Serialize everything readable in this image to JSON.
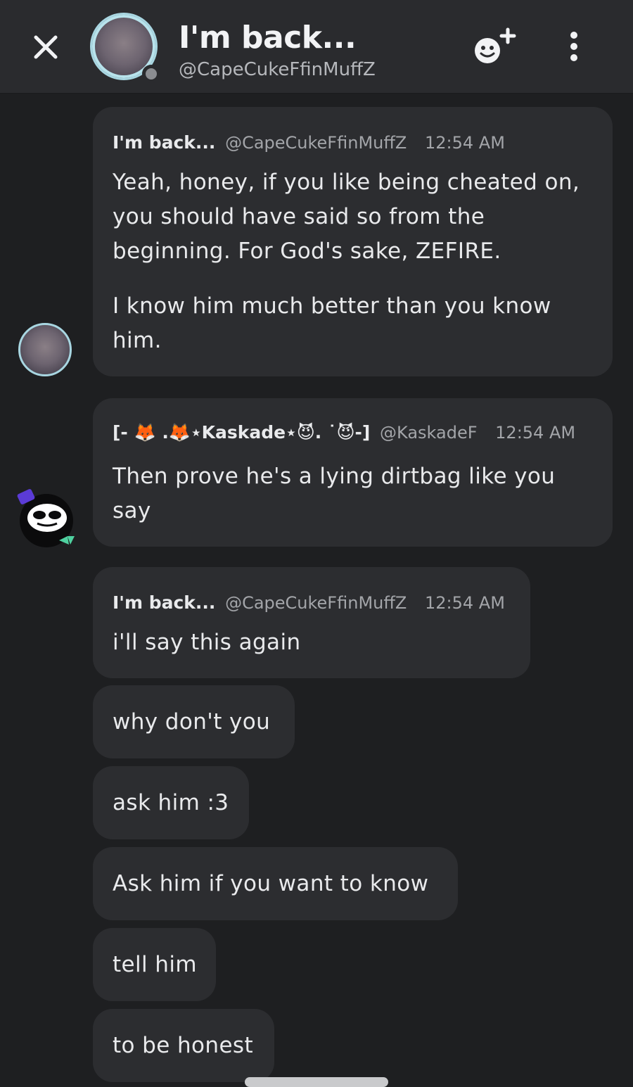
{
  "header": {
    "title": "I'm back...",
    "handle": "@CapeCukeFfinMuffZ",
    "close_icon": "close-icon",
    "add_friend_icon": "add-friend-icon",
    "more_icon": "more-vertical-icon"
  },
  "messages": [
    {
      "author": "I'm back...",
      "username": "@CapeCukeFfinMuffZ",
      "time": "12:54 AM",
      "paragraphs": [
        "Yeah, honey, if you like being cheated on, you should have said so from the beginning. For God's sake, ZEFIRE.",
        "I know him much better than you know him."
      ]
    },
    {
      "author": "[- 🦊 .🦊⋆Kaskade⋆😈. ˙😈-]",
      "username": "@KaskadeF",
      "time": "12:54 AM",
      "paragraphs": [
        "Then prove he's a lying dirtbag like you say"
      ]
    },
    {
      "author": "I'm back...",
      "username": "@CapeCukeFfinMuffZ",
      "time": "12:54 AM",
      "paragraphs": [
        "i'll say this again"
      ]
    }
  ],
  "followups": [
    "why don't you",
    "ask him :3",
    "Ask him if you want to know",
    "tell him",
    "to be honest"
  ],
  "colors": {
    "background": "#1e1f21",
    "header": "#2a2b2e",
    "bubble": "#2c2d30",
    "avatar_ring": "#a8d6e1"
  }
}
